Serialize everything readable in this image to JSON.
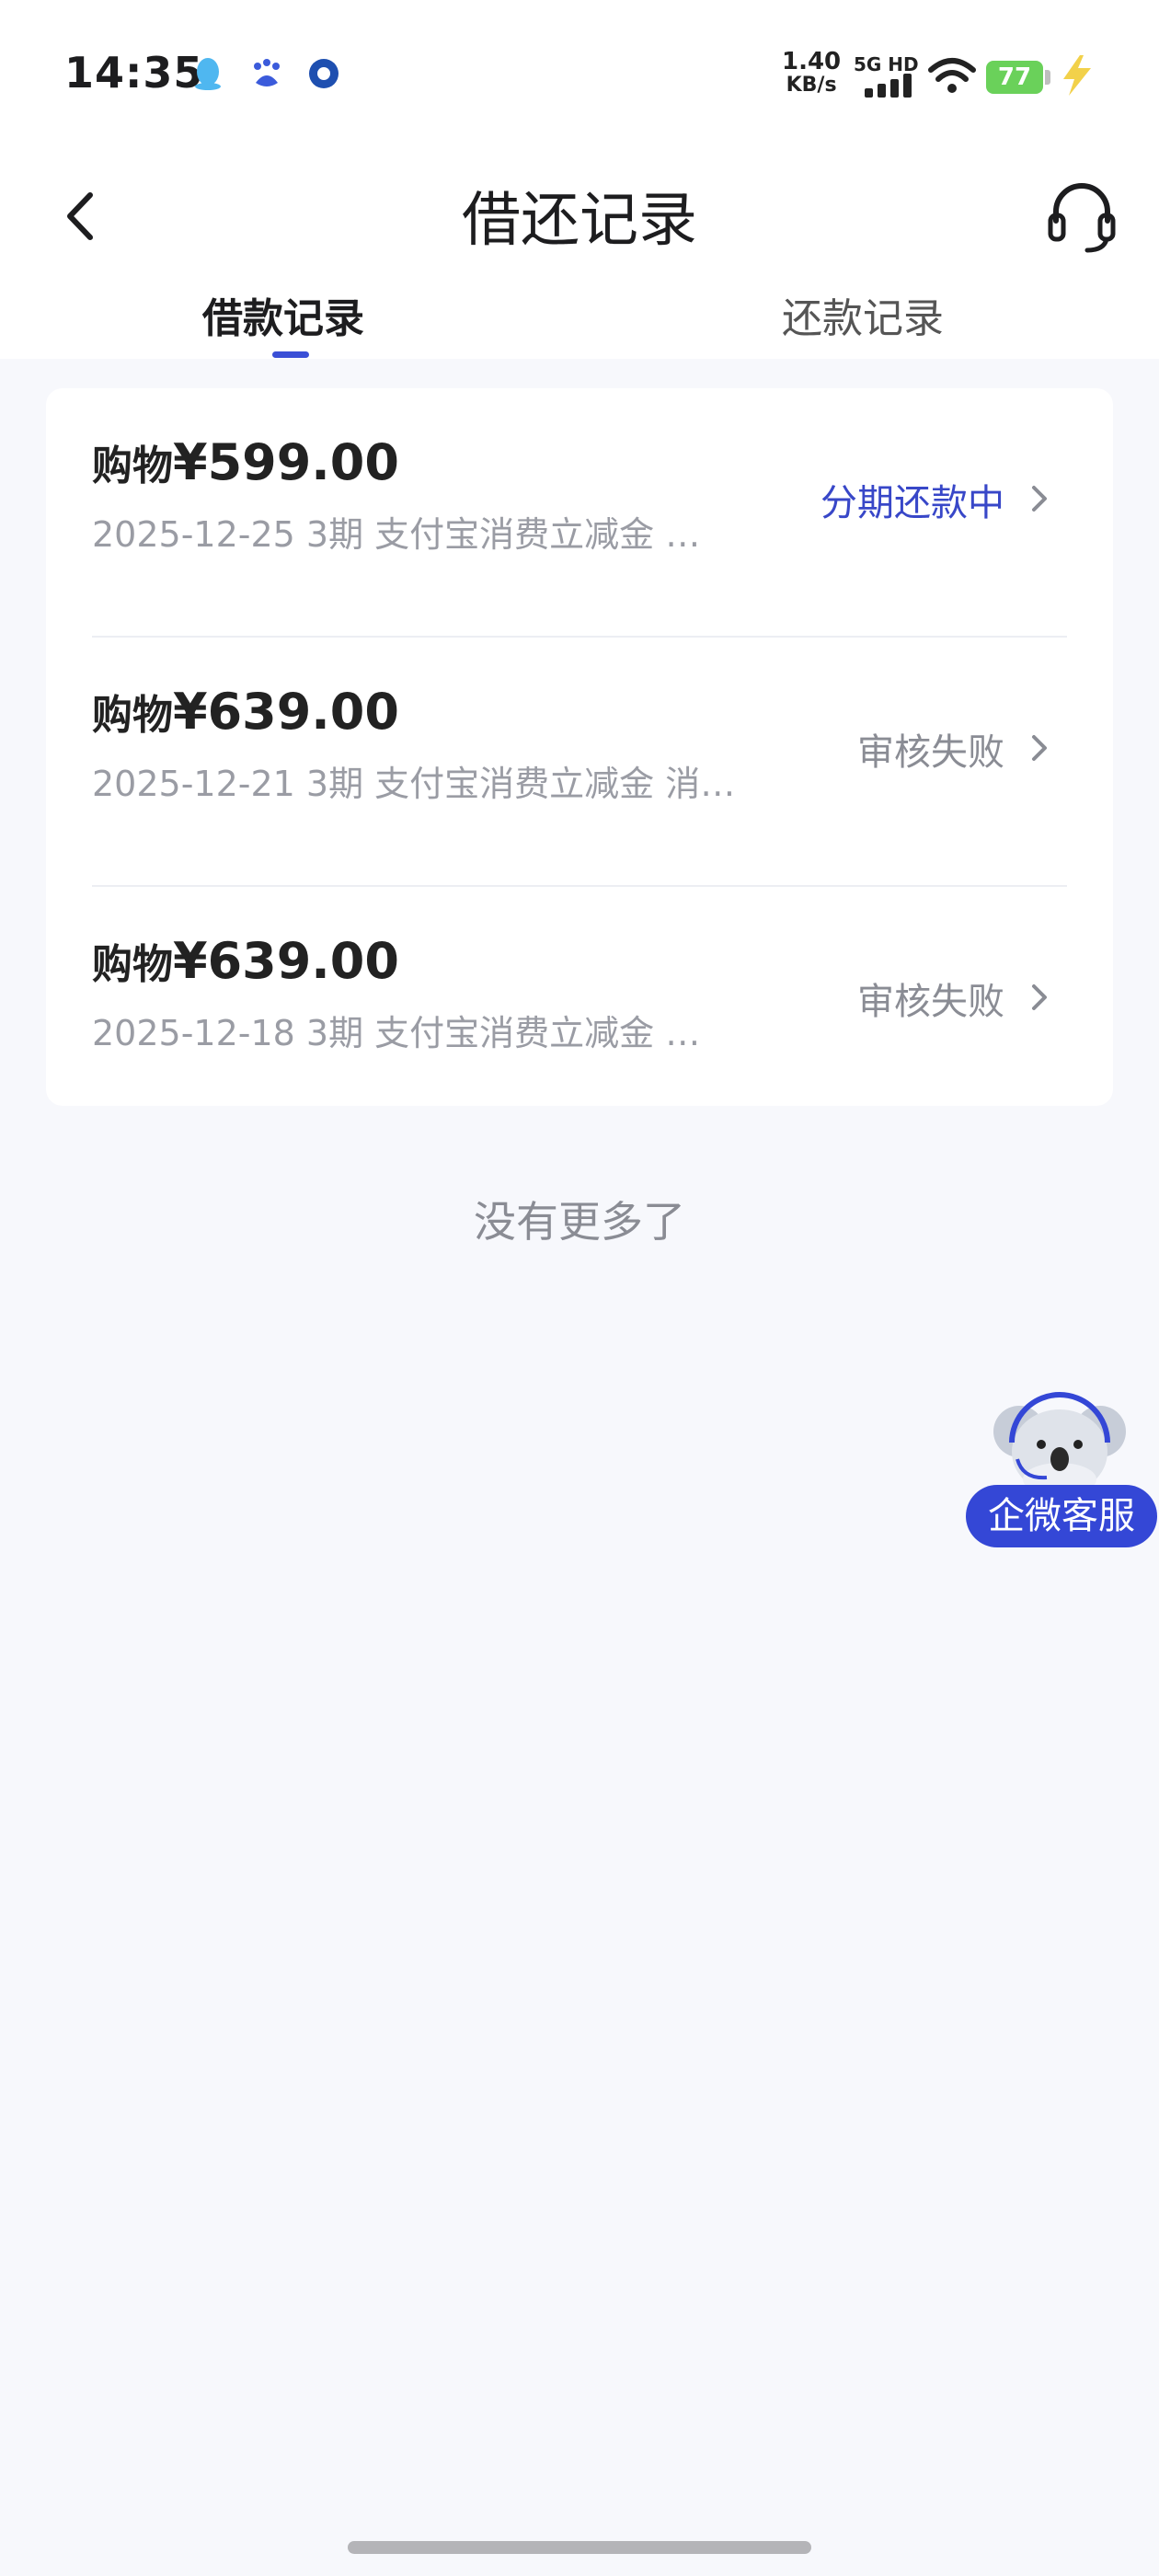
{
  "status_bar": {
    "time": "14:35",
    "speed_value": "1.40",
    "speed_unit": "KB/s",
    "network": "5G HD",
    "battery": "77",
    "icons": [
      "qq-icon",
      "baidu-icon",
      "bank-app-icon",
      "signal-icon",
      "wifi-icon",
      "battery-icon",
      "charging-icon"
    ]
  },
  "header": {
    "title": "借还记录",
    "back_icon": "chevron-left-icon",
    "service_icon": "headset-icon"
  },
  "tabs": [
    {
      "label": "借款记录",
      "active": true
    },
    {
      "label": "还款记录",
      "active": false
    }
  ],
  "records": [
    {
      "prefix": "购物",
      "amount": "¥599.00",
      "detail": "2025-12-25 3期  支付宝消费立减金 …",
      "status": "分期还款中",
      "status_type": "active"
    },
    {
      "prefix": "购物",
      "amount": "¥639.00",
      "detail": "2025-12-21 3期  支付宝消费立减金 消…",
      "status": "审核失败",
      "status_type": "failed"
    },
    {
      "prefix": "购物",
      "amount": "¥639.00",
      "detail": "2025-12-18 3期  支付宝消费立减金 …",
      "status": "审核失败",
      "status_type": "failed"
    }
  ],
  "footer_text": "没有更多了",
  "floating_service": {
    "label": "企微客服",
    "icon": "koala-mascot-icon"
  },
  "colors": {
    "accent": "#3a4fd6",
    "background": "#f7f8fc",
    "status_active": "#3847c8",
    "status_muted": "#8a8c94",
    "battery": "#6ad15a"
  }
}
